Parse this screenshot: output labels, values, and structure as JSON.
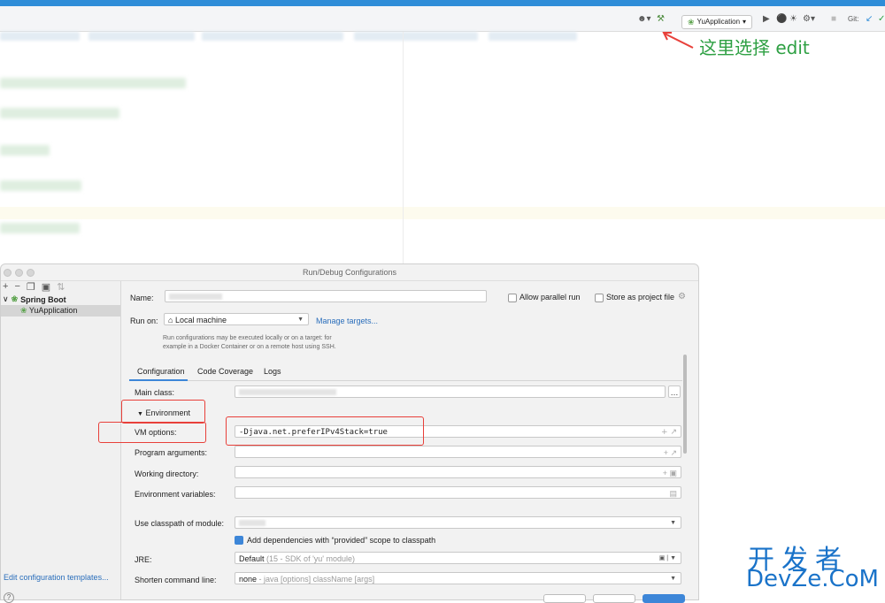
{
  "toolbar": {
    "run_config_label": "YuApplication",
    "git_label": "Git:"
  },
  "annotation": {
    "text": "这里选择 edit"
  },
  "dialog": {
    "title": "Run/Debug Configurations",
    "tree": {
      "group": "Spring Boot",
      "item": "YuApplication"
    },
    "edit_templates": "Edit configuration templates...",
    "name_label": "Name:",
    "allow_parallel": "Allow parallel run",
    "store_project": "Store as project file",
    "run_on_label": "Run on:",
    "run_on_value": "Local machine",
    "manage_targets": "Manage targets...",
    "run_on_help_1": "Run configurations may be executed locally or on a target: for",
    "run_on_help_2": "example in a Docker Container or on a remote host using SSH.",
    "tabs": [
      "Configuration",
      "Code Coverage",
      "Logs"
    ],
    "main_class_label": "Main class:",
    "environment_label": "Environment",
    "vm_options_label": "VM options:",
    "vm_options_value": "-Djava.net.preferIPv4Stack=true",
    "program_args_label": "Program arguments:",
    "working_dir_label": "Working directory:",
    "env_vars_label": "Environment variables:",
    "classpath_label": "Use classpath of module:",
    "add_deps": "Add dependencies with “provided” scope to classpath",
    "jre_label": "JRE:",
    "jre_value": "Default",
    "jre_hint": "(15 - SDK of 'yu' module)",
    "shorten_label": "Shorten command line:",
    "shorten_value": "none",
    "shorten_hint": "- java [options] className [args]"
  },
  "watermark": {
    "line1": "开发者",
    "line2": "DevZe.CoM"
  }
}
